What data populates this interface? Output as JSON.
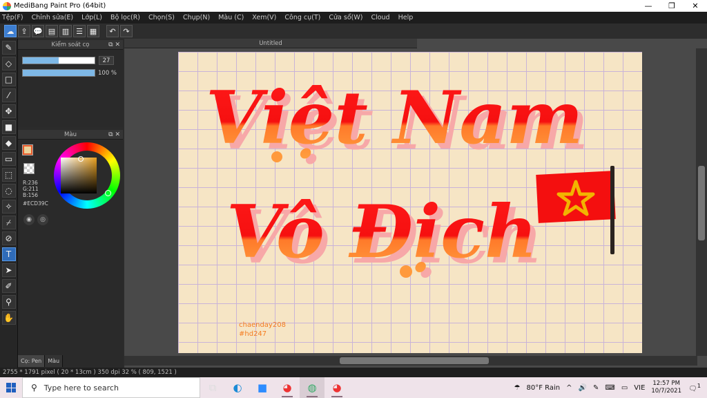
{
  "window": {
    "title": "MediBang Paint Pro (64bit)",
    "minimize": "—",
    "maximize": "❐",
    "close": "✕"
  },
  "menu": [
    "Tệp(F)",
    "Chỉnh sửa(E)",
    "Lớp(L)",
    "Bộ lọc(R)",
    "Chọn(S)",
    "Chụp(N)",
    "Màu (C)",
    "Xem(V)",
    "Công cụ(T)",
    "Cửa sổ(W)",
    "Cloud",
    "Help"
  ],
  "toolbar": {
    "icons": [
      "cloud-icon",
      "share-icon",
      "comment-icon",
      "chat-icon",
      "page-icon",
      "list-icon",
      "grid-icon"
    ],
    "undo_icon": "↶",
    "redo_icon": "↷"
  },
  "brush_panel": {
    "title": "Kiểm soát cọ",
    "size_value": "27",
    "size_fraction": 0.5,
    "opacity_label": "100 %",
    "opacity_fraction": 1.0
  },
  "color_panel": {
    "title": "Màu",
    "r": "R:236",
    "g": "G:211",
    "b": "B:156",
    "hex": "#ECD39C",
    "fg_color": "#ECD39C"
  },
  "bottom_tabs": [
    "Cọ: Pen",
    "Màu"
  ],
  "document": {
    "tab_title": "Untitled",
    "line1": "Việt Nam",
    "line2": "Vô Địch",
    "signature1": "chaenday208",
    "signature2": "#hd247"
  },
  "status": {
    "text": "2755 * 1791 pixel   ( 20 * 13cm )   350 dpi   32 %   ( 809, 1521 )"
  },
  "taskbar": {
    "search_placeholder": "Type here to search",
    "weather": "80°F  Rain",
    "lang": "VIE",
    "time": "12:57 PM",
    "date": "10/7/2021",
    "notification_count": "1"
  }
}
